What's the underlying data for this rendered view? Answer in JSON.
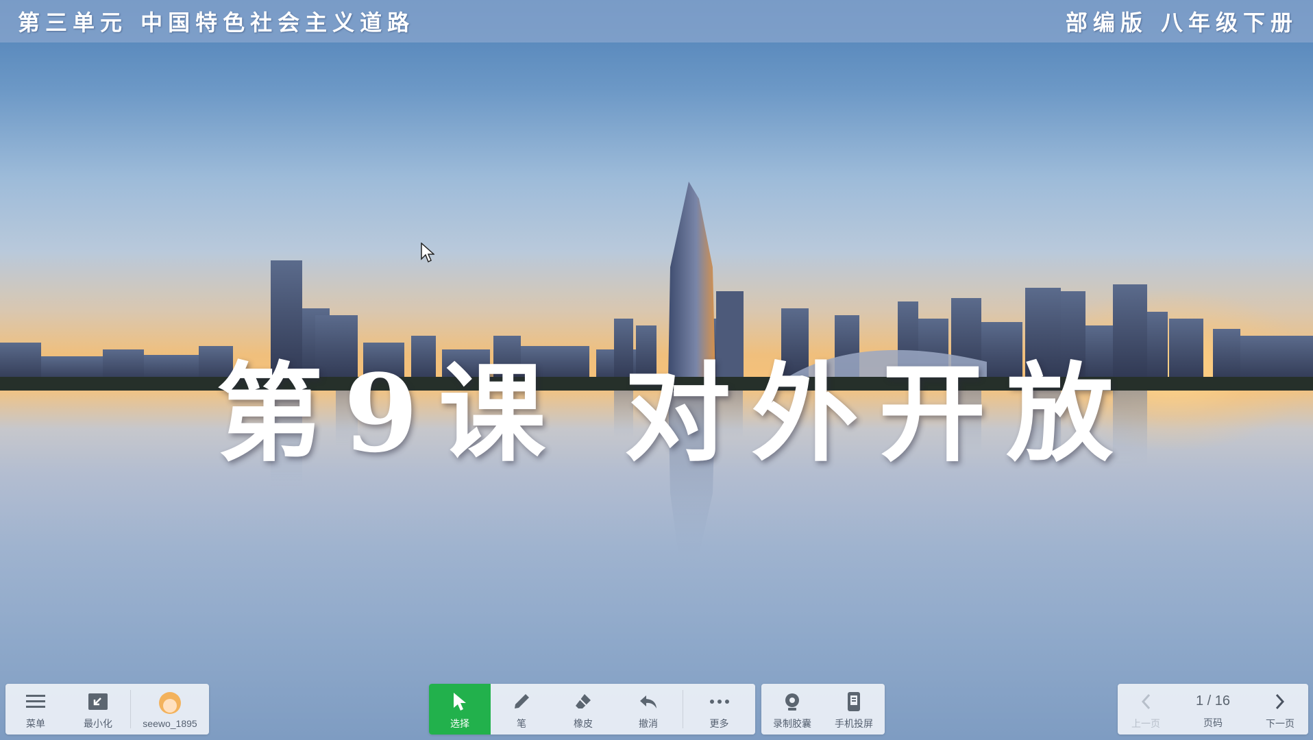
{
  "header": {
    "unit_title": "第三单元 中国特色社会主义道路",
    "edition": "部编版 八年级下册"
  },
  "slide": {
    "lesson_title": "第9课 对外开放"
  },
  "left_toolbar": {
    "menu_label": "菜单",
    "minimize_label": "最小化",
    "user_label": "seewo_1895"
  },
  "center_toolbar": {
    "select_label": "选择",
    "pen_label": "笔",
    "eraser_label": "橡皮",
    "undo_label": "撤消",
    "more_label": "更多"
  },
  "right_toolbar": {
    "record_label": "录制胶囊",
    "cast_label": "手机投屏"
  },
  "pager": {
    "prev_label": "上一页",
    "page_count": "1 / 16",
    "page_label": "页码",
    "next_label": "下一页"
  },
  "colors": {
    "active_tool": "#22b14c",
    "header_bar": "#8aa6cd",
    "toolbar_bg": "#ecf0f6"
  }
}
